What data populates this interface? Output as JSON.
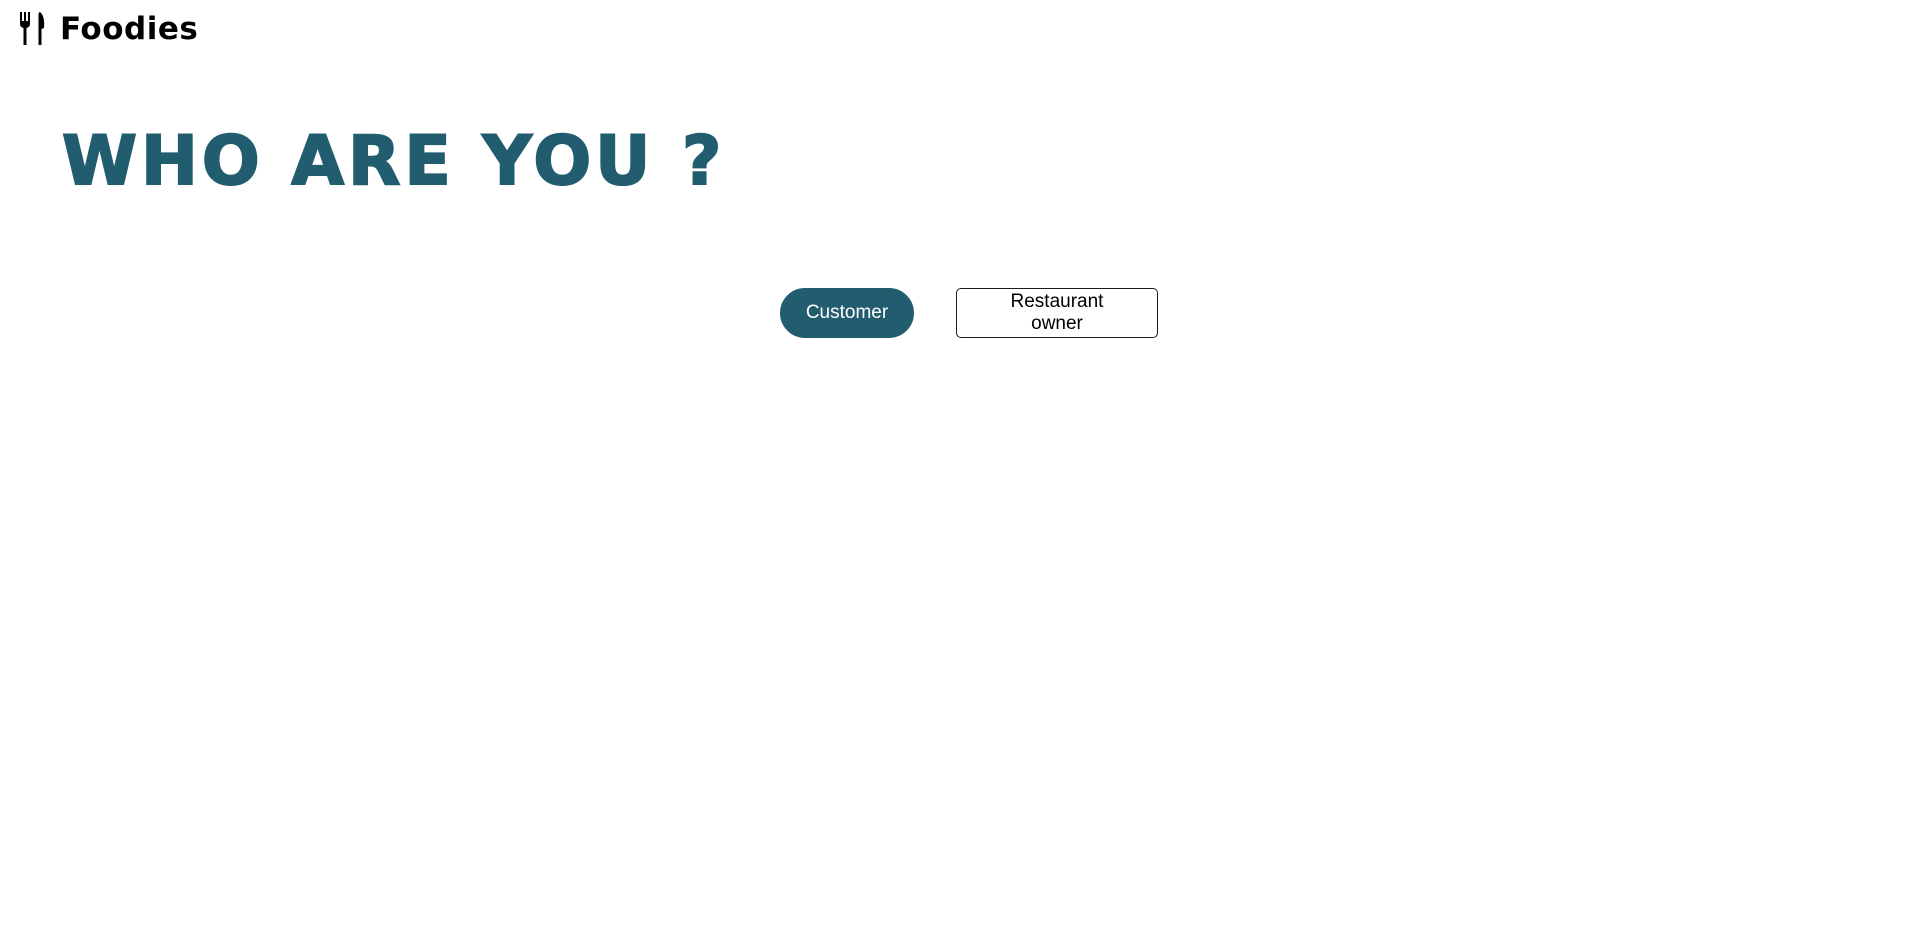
{
  "header": {
    "brand_icon": "fork-knife-icon",
    "brand_name": "Foodies"
  },
  "main": {
    "heading": "WHO ARE YOU ?",
    "heading_color": "#225d6f",
    "options": [
      {
        "label": "Customer",
        "style": "filled",
        "color": "#225d6f"
      },
      {
        "label": "Restaurant owner",
        "style": "outlined",
        "color": "#000000"
      }
    ]
  }
}
